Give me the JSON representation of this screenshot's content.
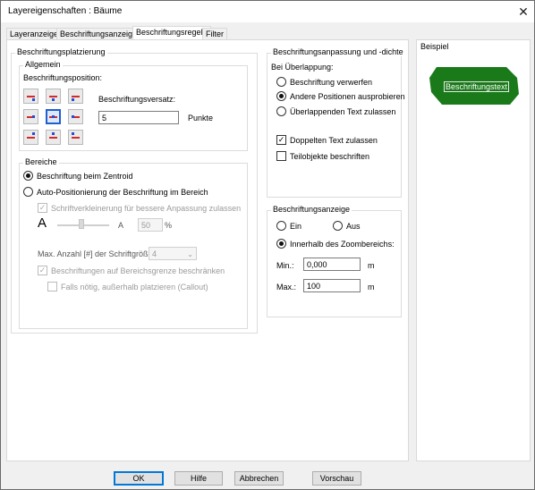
{
  "window": {
    "title": "Layereigenschaften : Bäume",
    "close_glyph": "✕"
  },
  "tabs": [
    {
      "label": "Layeranzeige"
    },
    {
      "label": "Beschriftungsanzeige"
    },
    {
      "label": "Beschriftungsregeln"
    },
    {
      "label": "Filter"
    }
  ],
  "placement": {
    "group_label": "Beschriftungsplatzierung",
    "allgemein": {
      "label": "Allgemein",
      "position_label": "Beschriftungsposition:",
      "offset_label": "Beschriftungsversatz:",
      "offset_value": "5",
      "offset_unit": "Punkte"
    },
    "bereiche": {
      "label": "Bereiche",
      "centroid_label": "Beschriftung beim Zentroid",
      "centroid_selected": true,
      "auto_label": "Auto-Positionierung der Beschriftung im Bereich",
      "shrink_label": "Schriftverkleinerung für bessere Anpassung zulassen",
      "big_a": "A",
      "small_a": "A",
      "percent_value": "50",
      "percent_unit": "%",
      "max_fonts_label": "Max. Anzahl [#] der Schriftgrößen:",
      "max_fonts_value": "4",
      "restrict_label": "Beschriftungen auf Bereichsgrenze beschränken",
      "callout_label": "Falls nötig, außerhalb platzieren (Callout)"
    }
  },
  "overlap": {
    "group_label": "Beschriftungsanpassung und -dichte",
    "subtitle": "Bei Überlappung:",
    "options": [
      {
        "label": "Beschriftung verwerfen",
        "selected": false
      },
      {
        "label": "Andere Positionen ausprobieren",
        "selected": true
      },
      {
        "label": "Überlappenden Text zulassen",
        "selected": false
      }
    ],
    "duplicate_label": "Doppelten Text zulassen",
    "duplicate_checked": true,
    "subobjects_label": "Teilobjekte beschriften",
    "subobjects_checked": false
  },
  "display": {
    "group_label": "Beschriftungsanzeige",
    "on_label": "Ein",
    "off_label": "Aus",
    "zoom_label": "Innerhalb des Zoombereichs:",
    "zoom_selected": true,
    "min_label": "Min.:",
    "min_value": "0,000",
    "max_label": "Max.:",
    "max_value": "100",
    "unit": "m"
  },
  "example": {
    "group_label": "Beispiel",
    "sample_text": "Beschriftungstext",
    "fill_color": "#1a7a1a"
  },
  "buttons": {
    "ok": "OK",
    "help": "Hilfe",
    "cancel": "Abbrechen",
    "preview": "Vorschau"
  }
}
